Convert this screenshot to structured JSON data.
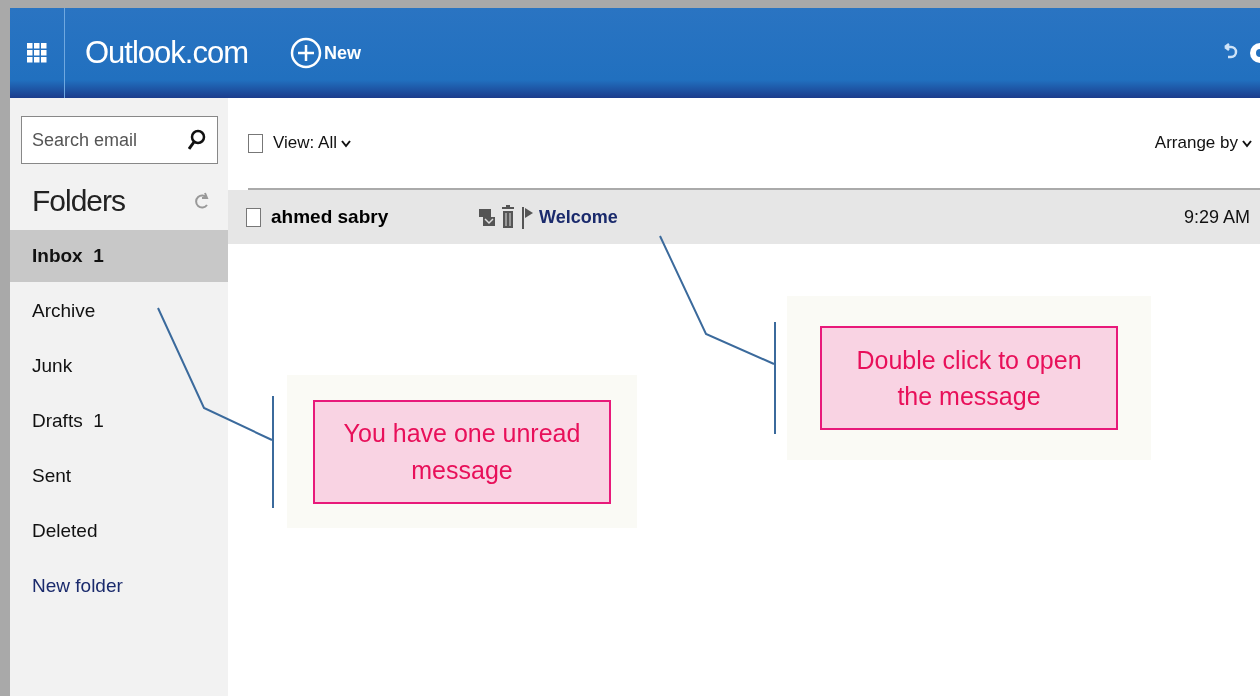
{
  "header": {
    "app_title": "Outlook.com",
    "new_button": "New"
  },
  "sidebar": {
    "search": {
      "placeholder": "Search email"
    },
    "folders_title": "Folders",
    "folders": [
      {
        "name": "Inbox",
        "count": "1",
        "selected": true
      },
      {
        "name": "Archive",
        "selected": false
      },
      {
        "name": "Junk",
        "selected": false
      },
      {
        "name": "Drafts",
        "count": "1",
        "selected": false
      },
      {
        "name": "Sent",
        "selected": false
      },
      {
        "name": "Deleted",
        "selected": false
      },
      {
        "name": "New folder",
        "kind": "link",
        "selected": false
      }
    ]
  },
  "toolbar": {
    "view": "View: All",
    "view_checked": false,
    "arrange": "Arrange by"
  },
  "messages": [
    {
      "sender": "ahmed sabry",
      "subject": "Welcome",
      "time": "9:29 AM",
      "checked": false,
      "selected": true
    }
  ],
  "callouts": [
    {
      "text": "You have one unread message"
    },
    {
      "text": "Double click to open the message"
    }
  ]
}
